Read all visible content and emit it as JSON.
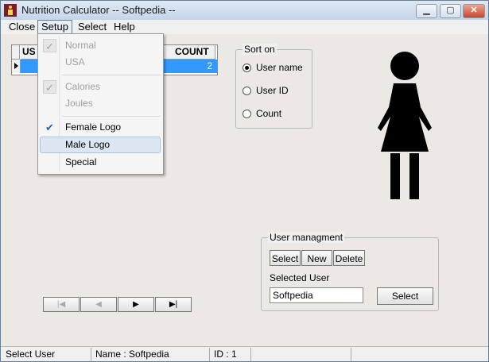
{
  "window": {
    "title": "Nutrition Calculator -- Softpedia --",
    "controls": {
      "minimize": "▁",
      "maximize": "▢",
      "close": "✕"
    }
  },
  "menubar": {
    "items": [
      "Close",
      "Setup",
      "Select",
      "Help"
    ]
  },
  "setup_menu": {
    "items": [
      {
        "label": "Normal",
        "checked": true,
        "enabled": false
      },
      {
        "label": "USA",
        "checked": false,
        "enabled": false
      },
      {
        "label": "Calories",
        "checked": true,
        "enabled": false
      },
      {
        "label": "Joules",
        "checked": false,
        "enabled": false
      },
      {
        "label": "Female Logo",
        "checked": true,
        "enabled": true
      },
      {
        "label": "Male Logo",
        "checked": false,
        "enabled": true,
        "highlighted": true
      },
      {
        "label": "Special",
        "checked": false,
        "enabled": true
      }
    ]
  },
  "grid": {
    "columns": [
      "US",
      "COUNT"
    ],
    "rows": [
      {
        "count": "2"
      }
    ]
  },
  "sort_on": {
    "legend": "Sort on",
    "options": [
      "User name",
      "User ID",
      "Count"
    ],
    "selected": "User name"
  },
  "navigator": {
    "buttons": [
      "|◀",
      "◀",
      "▶",
      "▶|"
    ]
  },
  "user_management": {
    "legend": "User managment",
    "tabs": [
      "Select",
      "New",
      "Delete"
    ],
    "selected_user_label": "Selected User",
    "selected_user_value": "Softpedia",
    "select_button": "Select"
  },
  "statusbar": {
    "status": "Select User",
    "name": "Name : Softpedia",
    "id": "ID : 1"
  },
  "colors": {
    "selection": "#3399ff",
    "check_blue": "#1f5fc0"
  },
  "icons": {
    "logo": "female-figure-icon",
    "app": "person-icon"
  }
}
